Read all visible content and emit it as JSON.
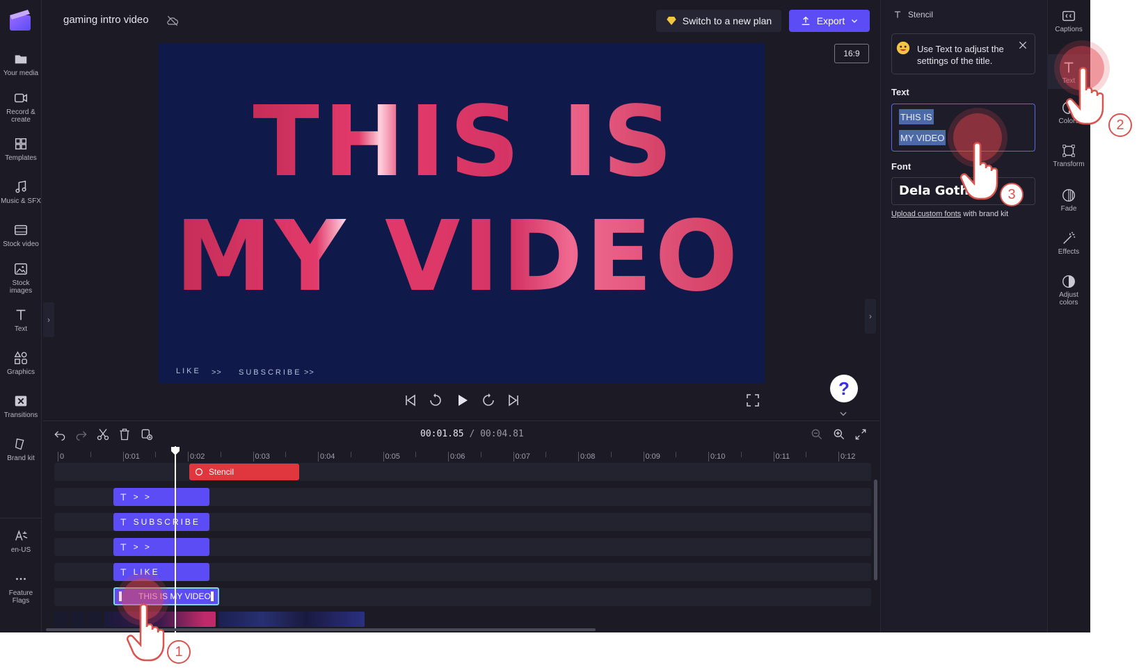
{
  "project": {
    "title": "gaming intro video"
  },
  "sidebar": {
    "items": [
      {
        "label": "Your media"
      },
      {
        "label": "Record &\ncreate"
      },
      {
        "label": "Templates"
      },
      {
        "label": "Music & SFX"
      },
      {
        "label": "Stock video"
      },
      {
        "label": "Stock\nimages"
      },
      {
        "label": "Text"
      },
      {
        "label": "Graphics"
      },
      {
        "label": "Transitions"
      },
      {
        "label": "Brand kit"
      }
    ],
    "bottom": [
      {
        "label": "en-US"
      },
      {
        "label": "Feature\nFlags"
      }
    ]
  },
  "header": {
    "plan_label": "Switch to a new plan",
    "export_label": "Export"
  },
  "preview": {
    "aspect_ratio": "16:9",
    "line1": "THIS IS",
    "line2": "MY VIDEO",
    "footer_like": "LIKE",
    "footer_arrow1": ">>",
    "footer_subscribe": "SUBSCRIBE",
    "footer_arrow2": ">>"
  },
  "playback": {
    "current": "00:01.85",
    "total": "/ 00:04.81",
    "help_label": "?"
  },
  "timeline": {
    "ticks": [
      "0",
      "0:01",
      "0:02",
      "0:03",
      "0:04",
      "0:05",
      "0:06",
      "0:07",
      "0:08",
      "0:09",
      "0:10",
      "0:11",
      "0:12"
    ],
    "stencil_clip": "Stencil",
    "text_clips": [
      {
        "label": "> >"
      },
      {
        "label": "SUBSCRIBE"
      },
      {
        "label": "> >"
      },
      {
        "label": "LIKE"
      },
      {
        "label": "THIS IS MY VIDEO"
      }
    ]
  },
  "panel": {
    "header": "Stencil",
    "tip": "Use Text to adjust the settings of the title.",
    "text_label": "Text",
    "text_line1": "THIS IS",
    "text_line2": "MY VIDEO",
    "font_label": "Font",
    "font_value": "Dela Gothi",
    "upload_link": "Upload custom fonts",
    "upload_suffix": "with brand kit"
  },
  "right_toolbar": {
    "items": [
      {
        "label": "Captions"
      },
      {
        "label": "Text"
      },
      {
        "label": "Colors"
      },
      {
        "label": "Transform"
      },
      {
        "label": "Fade"
      },
      {
        "label": "Effects"
      },
      {
        "label": "Adjust\ncolors"
      }
    ]
  },
  "tutorial": {
    "step1": "1",
    "step2": "2",
    "step3": "3"
  },
  "colors": {
    "accent": "#5b4cf5",
    "stencil": "#e0373f",
    "title_pink": "#e23a6a",
    "preview_bg": "#0f1a4a"
  }
}
